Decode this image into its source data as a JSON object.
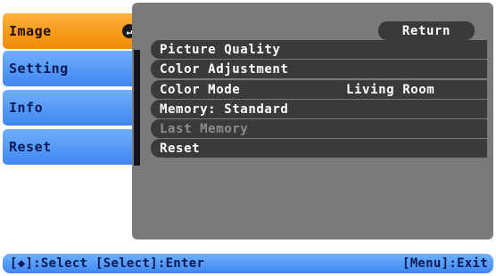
{
  "tabs": [
    {
      "label": "Image",
      "active": true
    },
    {
      "label": "Setting",
      "active": false
    },
    {
      "label": "Info",
      "active": false
    },
    {
      "label": "Reset",
      "active": false
    }
  ],
  "enter_icon": "enter-arrow-icon",
  "menu": {
    "return_label": "Return",
    "items": [
      {
        "label": "Picture Quality",
        "value": "",
        "enabled": true
      },
      {
        "label": "Color Adjustment",
        "value": "",
        "enabled": true
      },
      {
        "label": "Color Mode",
        "value": "Living Room",
        "enabled": true
      },
      {
        "label": "Memory: Standard",
        "value": "",
        "enabled": true
      },
      {
        "label": "Last Memory",
        "value": "",
        "enabled": false
      },
      {
        "label": "Reset",
        "value": "",
        "enabled": true
      }
    ]
  },
  "statusbar": {
    "left": "[◆]:Select [Select]:Enter",
    "right": "[Menu]:Exit"
  },
  "colors": {
    "active_tab": "#f08a00",
    "inactive_tab": "#3f86f0",
    "panel": "#7a7a7a",
    "row": "#3a3a3a"
  }
}
